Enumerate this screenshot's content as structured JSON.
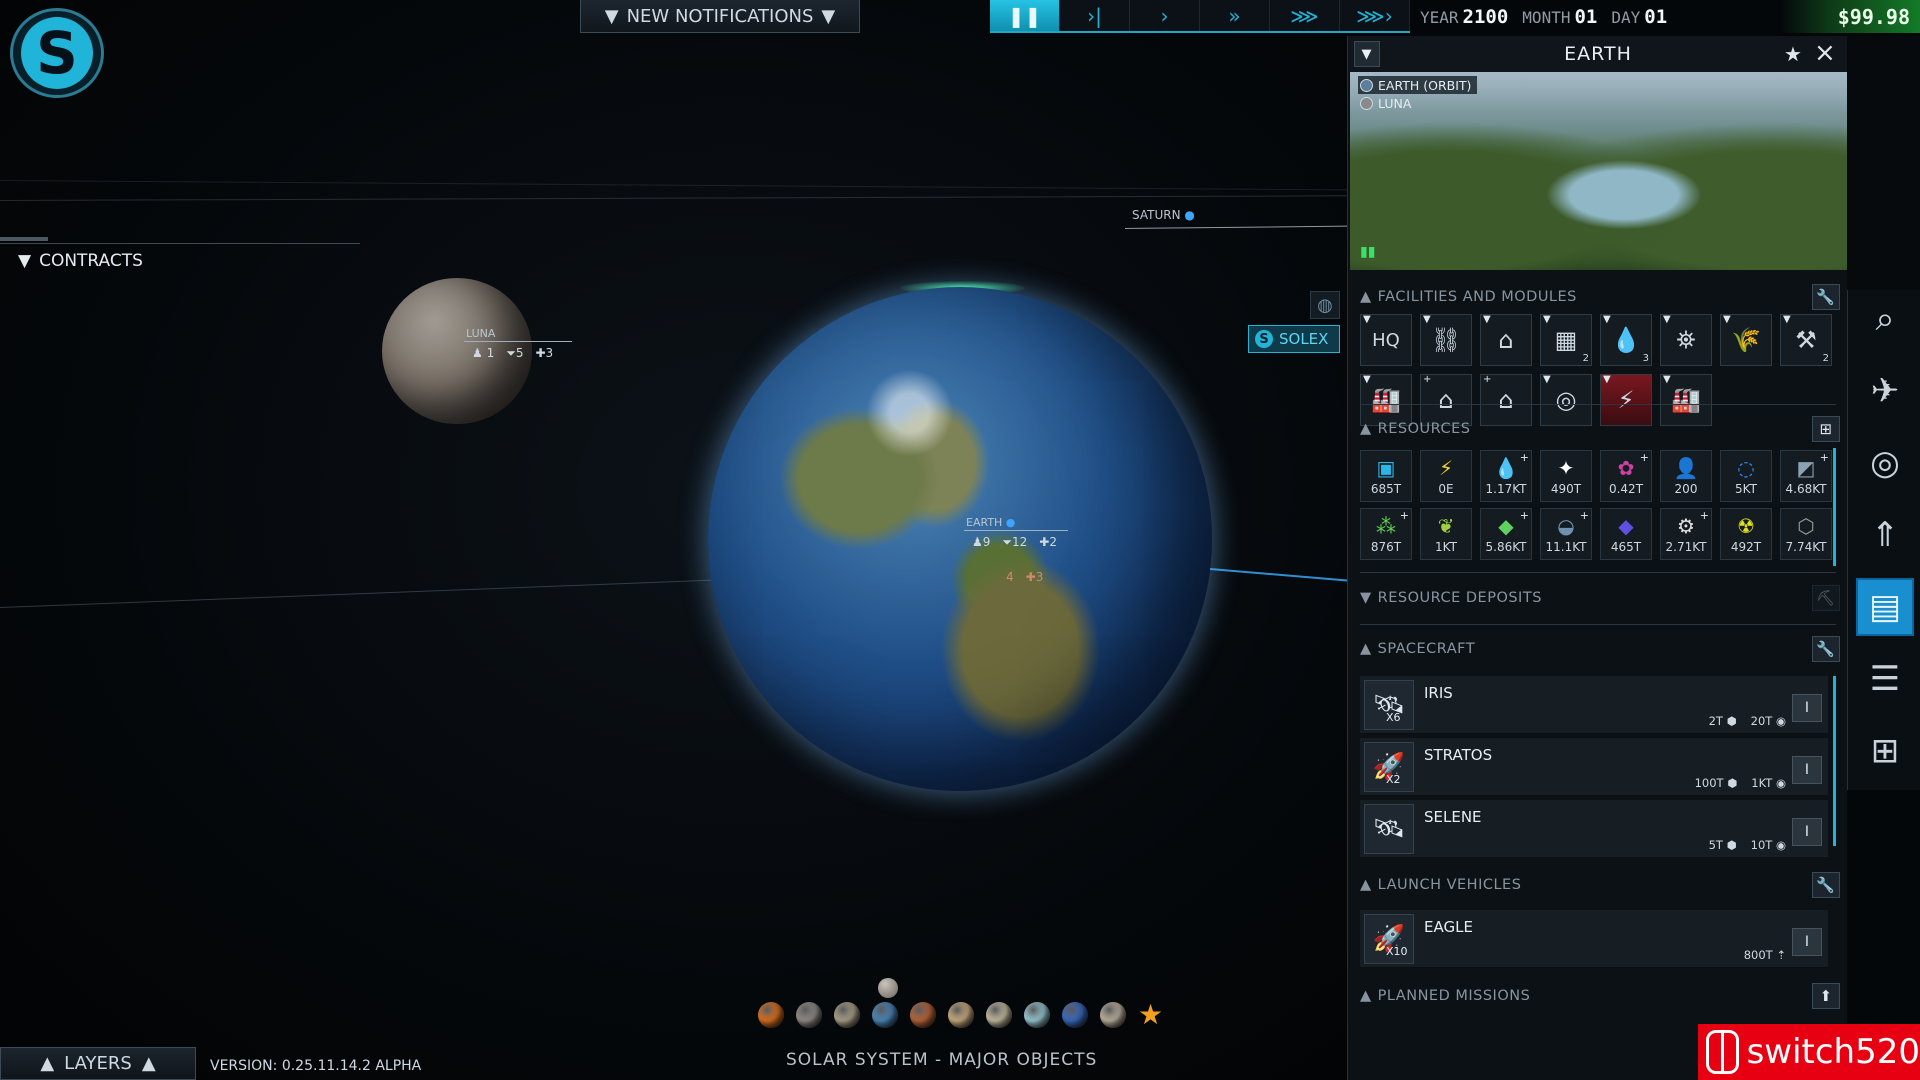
{
  "top": {
    "notifications_label": "NEW NOTIFICATIONS",
    "year_label": "YEAR",
    "year": "2100",
    "month_label": "MONTH",
    "month": "01",
    "day_label": "DAY",
    "day": "01",
    "money": "$99.98",
    "speed_buttons": [
      "pause",
      "step",
      "play",
      "fast",
      "faster",
      "fastest"
    ]
  },
  "contracts_label": "CONTRACTS",
  "map": {
    "saturn_label": "SATURN",
    "luna": {
      "label": "LUNA",
      "stat1": "1",
      "stat2": "5",
      "stat3": "3"
    },
    "earth": {
      "label": "EARTH",
      "stat1": "9",
      "stat2": "12",
      "stat3": "2",
      "sub1": "4",
      "sub2": "3"
    },
    "solex_label": "SOLEX"
  },
  "bottom": {
    "layers_label": "LAYERS",
    "version": "VERSION: 0.25.11.14.2 ALPHA",
    "solar_label": "SOLAR SYSTEM - MAJOR OBJECTS",
    "planet_colors": [
      "#e8761e",
      "#9a948c",
      "#b5a98f",
      "#4f8ec4",
      "#c2693a",
      "#d7b586",
      "#cfc6a8",
      "#9fd3df",
      "#3d6fc9",
      "#c7bba7"
    ]
  },
  "panel": {
    "title": "EARTH",
    "locations": [
      "EARTH (ORBIT)",
      "LUNA"
    ],
    "facilities_header": "FACILITIES AND MODULES",
    "facilities": [
      {
        "icon": "HQ",
        "count": ""
      },
      {
        "icon": "⛓",
        "count": ""
      },
      {
        "icon": "⌂",
        "count": ""
      },
      {
        "icon": "▦",
        "count": "2"
      },
      {
        "icon": "💧",
        "count": "3"
      },
      {
        "icon": "⛯",
        "count": ""
      },
      {
        "icon": "🌾",
        "count": ""
      },
      {
        "icon": "⚒",
        "count": "2"
      },
      {
        "icon": "🏭",
        "count": ""
      },
      {
        "icon": "⌂",
        "count": ""
      },
      {
        "icon": "⌂",
        "count": ""
      },
      {
        "icon": "◎",
        "count": ""
      },
      {
        "icon": "⚡",
        "count": ""
      },
      {
        "icon": "🏭",
        "count": ""
      }
    ],
    "resources_header": "RESOURCES",
    "resources": [
      {
        "icon": "▣",
        "color": "#29b6e8",
        "value": "685T",
        "plus": false
      },
      {
        "icon": "⚡",
        "color": "#f2d22e",
        "value": "0E",
        "plus": false
      },
      {
        "icon": "💧",
        "color": "#c060e0",
        "value": "1.17KT",
        "plus": true
      },
      {
        "icon": "✦",
        "color": "#ffffff",
        "value": "490T",
        "plus": false
      },
      {
        "icon": "✿",
        "color": "#d040a0",
        "value": "0.42T",
        "plus": true
      },
      {
        "icon": "👤",
        "color": "#e0a070",
        "value": "200",
        "plus": false
      },
      {
        "icon": "◌",
        "color": "#3090ff",
        "value": "5KT",
        "plus": false
      },
      {
        "icon": "◩",
        "color": "#8aa2b4",
        "value": "4.68KT",
        "plus": true
      },
      {
        "icon": "⁂",
        "color": "#5ed050",
        "value": "876T",
        "plus": true
      },
      {
        "icon": "❦",
        "color": "#a0d040",
        "value": "1KT",
        "plus": false
      },
      {
        "icon": "◆",
        "color": "#60d060",
        "value": "5.86KT",
        "plus": true
      },
      {
        "icon": "◒",
        "color": "#7090b0",
        "value": "11.1KT",
        "plus": true
      },
      {
        "icon": "◆",
        "color": "#6050e0",
        "value": "465T",
        "plus": false
      },
      {
        "icon": "⚙",
        "color": "#e0e0e0",
        "value": "2.71KT",
        "plus": true
      },
      {
        "icon": "☢",
        "color": "#e0e020",
        "value": "492T",
        "plus": false
      },
      {
        "icon": "⬡",
        "color": "#9a9a9a",
        "value": "7.74KT",
        "plus": false
      }
    ],
    "deposits_header": "RESOURCE DEPOSITS",
    "spacecraft_header": "SPACECRAFT",
    "spacecraft": [
      {
        "name": "IRIS",
        "mult": "x6",
        "cargo": "2T",
        "fuel": "20T"
      },
      {
        "name": "STRATOS",
        "mult": "x2",
        "cargo": "100T",
        "fuel": "1KT"
      },
      {
        "name": "SELENE",
        "mult": "",
        "cargo": "5T",
        "fuel": "10T"
      }
    ],
    "launch_header": "LAUNCH VEHICLES",
    "launch_vehicles": [
      {
        "name": "EAGLE",
        "mult": "x10",
        "stat": "800T"
      }
    ],
    "missions_header": "PLANNED MISSIONS"
  },
  "watermark": "switch520"
}
